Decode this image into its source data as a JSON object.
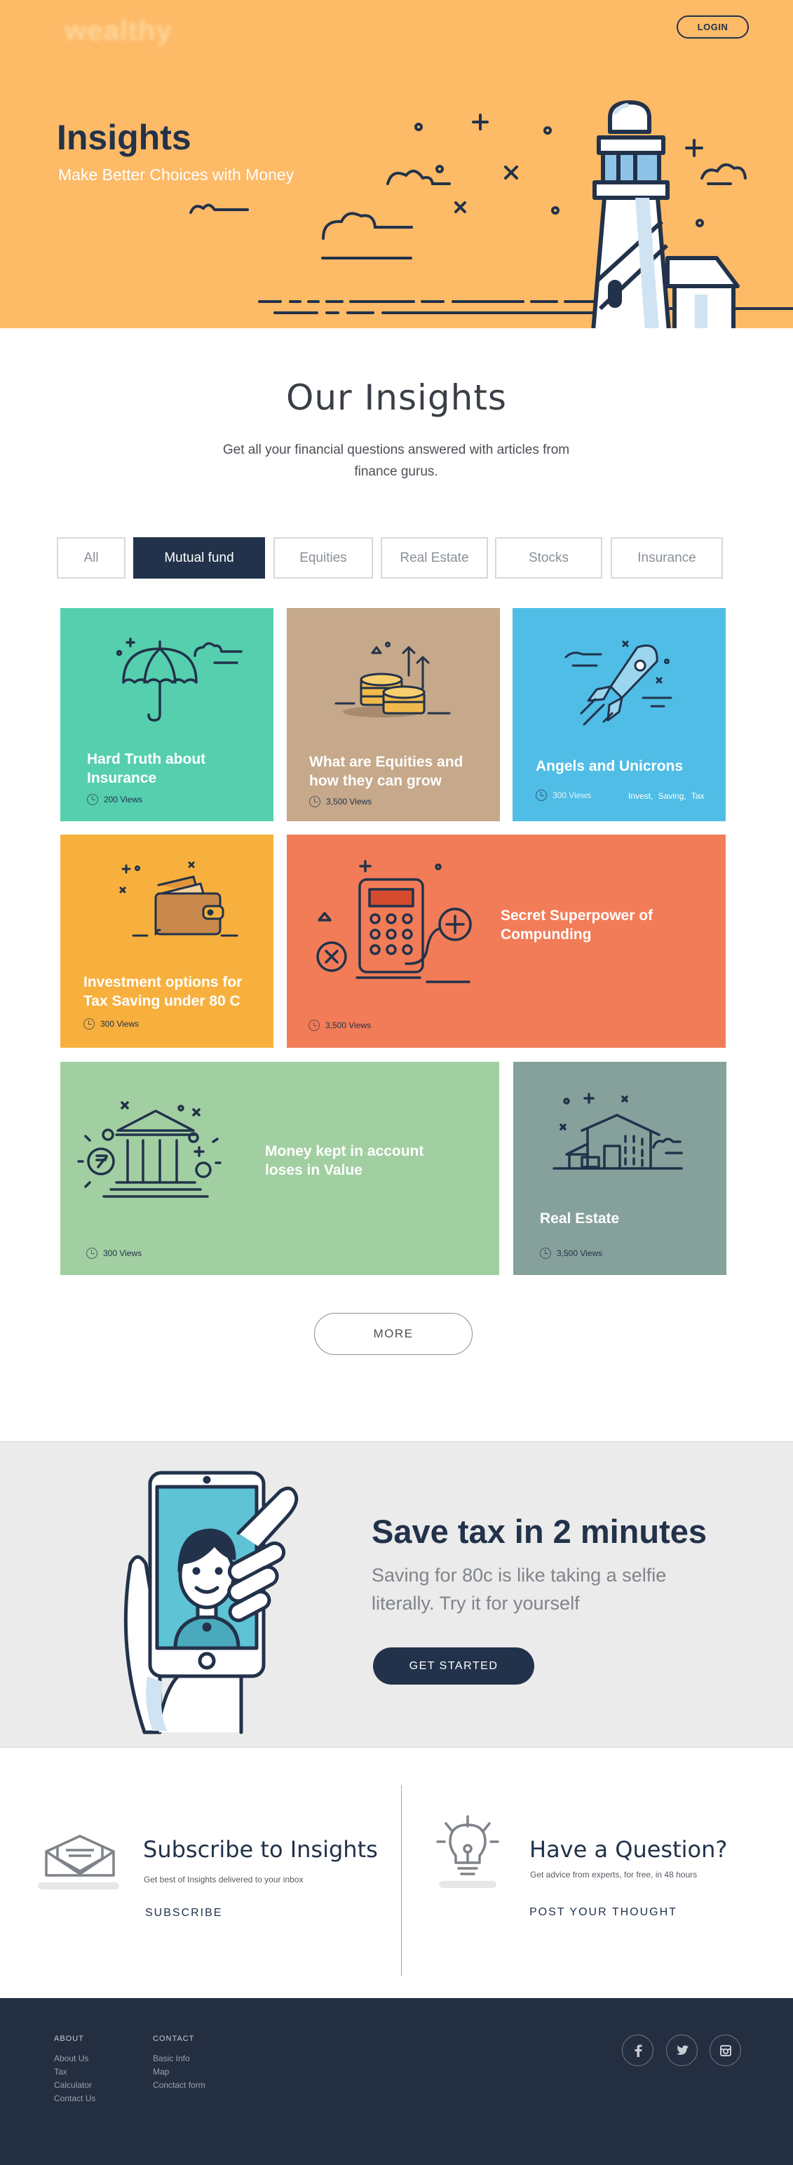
{
  "header": {
    "logo_text": "wealthy",
    "login_label": "LOGIN",
    "title": "Insights",
    "subtitle": "Make Better Choices with Money"
  },
  "insights": {
    "title": "Our Insights",
    "description": "Get all your financial questions answered with articles from finance gurus."
  },
  "filters": [
    "All",
    "Mutual fund",
    "Equities",
    "Real Estate",
    "Stocks",
    "Insurance"
  ],
  "active_filter": "Mutual fund",
  "cards": [
    {
      "title": "Hard Truth about Insurance",
      "views": "200 Views",
      "color": "#55cfae",
      "icon": "umbrella-icon"
    },
    {
      "title": "What are Equities and how they can grow",
      "views": "3,500 Views",
      "color": "#c6a88a",
      "icon": "coins-icon"
    },
    {
      "title": "Angels and Unicrons",
      "views": "300 Views",
      "tags": "Invest, Saving, Tax",
      "color": "#4fbde6",
      "icon": "rocket-icon"
    },
    {
      "title": "Investment options for Tax Saving under 80 C",
      "views": "300 Views",
      "color": "#f7b03e",
      "icon": "wallet-icon"
    },
    {
      "title": "Secret Superpower of Compunding",
      "views": "3,500 Views",
      "color": "#f27c58",
      "icon": "calculator-icon"
    },
    {
      "title": "Money kept in account loses in Value",
      "views": "300 Views",
      "color": "#a2cfa2",
      "icon": "bank-icon"
    },
    {
      "title": "Real Estate",
      "views": "3,500 Views",
      "color": "#86a19b",
      "icon": "house-icon"
    }
  ],
  "more_label": "MORE",
  "tax": {
    "title": "Save tax in 2 minutes",
    "subtitle": "Saving for 80c is like taking a selfie literally. Try it for yourself",
    "button": "GET STARTED"
  },
  "subscribe": {
    "title": "Subscribe to Insights",
    "desc": "Get best of Insights delivered to your inbox",
    "link": "SUBSCRIBE"
  },
  "question": {
    "title": "Have a Question?",
    "desc": "Get advice from experts, for free, in 48 hours",
    "link": "POST YOUR THOUGHT"
  },
  "footer": {
    "about_head": "ABOUT",
    "about_links": [
      "About Us",
      "Tax",
      "Calculator",
      "Contact Us"
    ],
    "contact_head": "CONTACT",
    "contact_links": [
      "Basic Info",
      "Map",
      "Conctact form"
    ],
    "social": [
      "facebook-icon",
      "twitter-icon",
      "instagram-icon"
    ]
  },
  "colors": {
    "hero": "#fdba67",
    "navy": "#22324a",
    "footer": "#242e41"
  }
}
